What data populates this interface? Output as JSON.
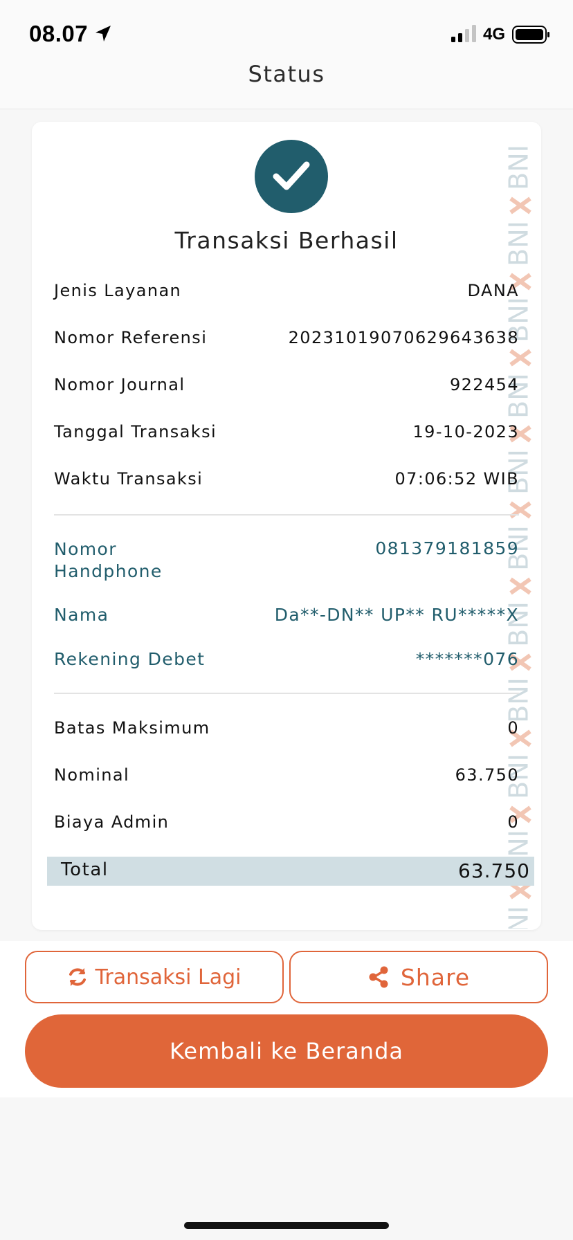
{
  "status_bar": {
    "time": "08.07",
    "network": "4G"
  },
  "header": {
    "title": "Status"
  },
  "receipt": {
    "result_title": "Transaksi Berhasil",
    "details": [
      {
        "label": "Jenis Layanan",
        "value": "DANA"
      },
      {
        "label": "Nomor Referensi",
        "value": "20231019070629643638"
      },
      {
        "label": "Nomor Journal",
        "value": "922454"
      },
      {
        "label": "Tanggal Transaksi",
        "value": "19-10-2023"
      },
      {
        "label": "Waktu Transaksi",
        "value": "07:06:52 WIB"
      }
    ],
    "customer": [
      {
        "label": "Nomor Handphone",
        "value": "081379181859"
      },
      {
        "label": "Nama",
        "value": "Da**-DN** UP** RU*****X"
      },
      {
        "label": "Rekening Debet",
        "value": "*******076"
      }
    ],
    "amounts": [
      {
        "label": "Batas Maksimum",
        "value": "0"
      },
      {
        "label": "Nominal",
        "value": "63.750"
      },
      {
        "label": "Biaya Admin",
        "value": "0"
      }
    ],
    "total": {
      "label": "Total",
      "value": "63.750"
    },
    "watermark_text": "BNI"
  },
  "actions": {
    "again_label": "Transaksi Lagi",
    "share_label": "Share",
    "home_label": "Kembali ke Beranda"
  },
  "colors": {
    "accent_orange": "#e0653a",
    "teal": "#215d6c",
    "total_bg": "#d0dee3"
  }
}
